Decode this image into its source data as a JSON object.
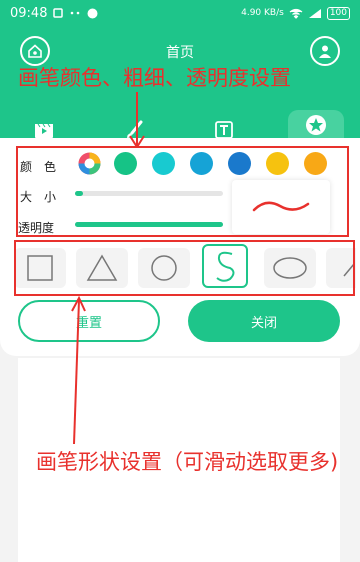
{
  "status_bar": {
    "time": "09:48",
    "network_speed": "4.90 KB/s",
    "battery": "100"
  },
  "header": {
    "title": "首页",
    "home_icon": "home-icon",
    "user_icon": "user-icon"
  },
  "annotations": {
    "top": "画笔颜色、粗细、透明度设置",
    "bottom": "画笔形状设置（可滑动选取更多)"
  },
  "tabs": [
    {
      "label": "教程",
      "icon": "video-icon",
      "active": false
    },
    {
      "label": "画笔",
      "icon": "brush-icon",
      "active": false
    },
    {
      "label": "文字",
      "icon": "text-icon",
      "active": false
    },
    {
      "label": "形状",
      "icon": "star-icon",
      "active": true
    }
  ],
  "settings": {
    "color_label": "颜　色",
    "size_label": "大　小",
    "opacity_label": "透明度",
    "size_value": 0.05,
    "opacity_value": 1.0,
    "colors": [
      "#16c386",
      "#18cad0",
      "#16a3d6",
      "#1a79cc",
      "#f6c20f",
      "#f8a816"
    ],
    "stroke_color": "#e8312d"
  },
  "shapes": [
    {
      "name": "square",
      "selected": false
    },
    {
      "name": "triangle",
      "selected": false
    },
    {
      "name": "circle",
      "selected": false
    },
    {
      "name": "curve",
      "selected": true
    },
    {
      "name": "ellipse",
      "selected": false
    },
    {
      "name": "line",
      "selected": false
    }
  ],
  "buttons": {
    "reset": "重置",
    "close": "关闭"
  },
  "colors": {
    "accent": "#1ec58a",
    "annotation": "#e8312d"
  }
}
